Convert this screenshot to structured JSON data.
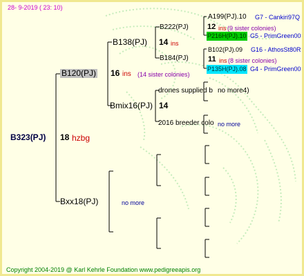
{
  "header": {
    "date": "28-  9-2019 (  23: 10)"
  },
  "footer": {
    "copyright": "Copyright 2004-2019 @ Karl Kehrle Foundation   www.pedigreeapis.org"
  },
  "root": {
    "name": "B323(PJ)",
    "count": "18",
    "note": "hzbg"
  },
  "gen1": {
    "top": {
      "name": "B120(PJ)",
      "count": "16",
      "note": "ins",
      "sisters": "(14 sister colonies)"
    },
    "bottom": {
      "name": "Bxx18(PJ)",
      "note": "no more"
    }
  },
  "gen2": {
    "b138": {
      "name": "B138(PJ)",
      "count": "14",
      "note": "ins"
    },
    "bmix": {
      "name": "Bmix16(PJ)",
      "count": "14"
    }
  },
  "gen3": {
    "b222": {
      "name": "B222(PJ)"
    },
    "b184": {
      "name": "B184(PJ)"
    },
    "drones": {
      "name": "drones supplied b",
      "note": "no more4)"
    },
    "breeder": {
      "name": "2016 breeder colo",
      "note": "no more"
    }
  },
  "gen4": {
    "a199": {
      "name": "A199(PJ).10",
      "info": "G7 - Cankiri97Q",
      "count": "12",
      "note": "ins",
      "sisters": "(9 sister colonies)"
    },
    "p216": {
      "name": "P216H(PJ).10",
      "info": "G5 - PrimGreen00"
    },
    "b102": {
      "name": "B102(PJ).09",
      "info": "G16 - AthosSt80R",
      "count": "11",
      "note": "ins",
      "sisters": "(8 sister colonies)"
    },
    "p135": {
      "name": "P135H(PJ).08",
      "info": "G4 - PrimGreen00"
    }
  },
  "colors": {
    "frame": "#f0e890",
    "background": "#ffffe6",
    "watermark": "#b8e8b0",
    "lines": "#000000"
  }
}
